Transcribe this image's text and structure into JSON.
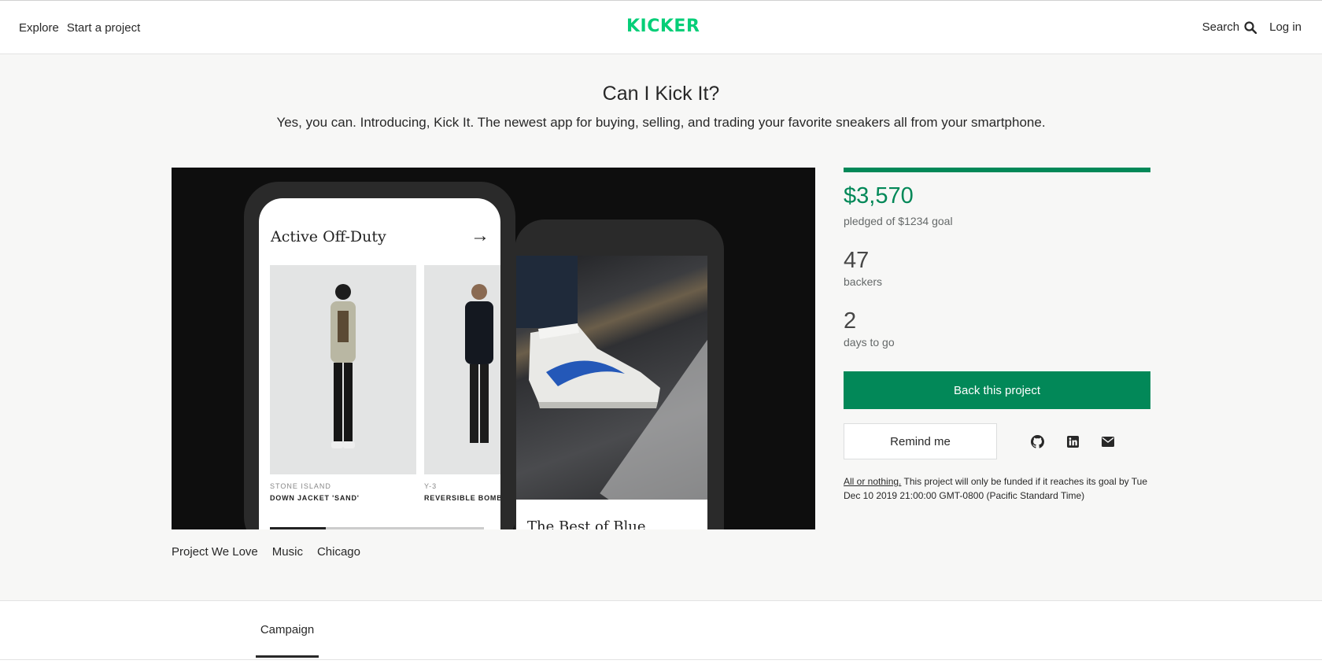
{
  "header": {
    "nav_left": [
      "Explore",
      "Start a project"
    ],
    "logo": "KICKER",
    "search_label": "Search",
    "login_label": "Log in"
  },
  "project": {
    "title": "Can I Kick It?",
    "subtitle": "Yes, you can.  Introducing,  Kick  It. The newest app for buying, selling, and trading your favorite sneakers all from your smartphone.",
    "image": {
      "phone1_title": "Active Off-Duty",
      "card1_brand": "STONE ISLAND",
      "card1_name": "DOWN JACKET 'SAND'",
      "card2_brand": "Y-3",
      "card2_name": "REVERSIBLE BOMBER",
      "phone2_card_text": "The Best of Blue",
      "phone1_scroll_fraction": 0.26
    },
    "tags": [
      "Project We  Love",
      "Music",
      "Chicago"
    ]
  },
  "stats": {
    "progress_fraction": 1.0,
    "pledged_amount": "$3,570",
    "pledged_label": "pledged of $1234 goal",
    "backers_count": "47",
    "backers_label": "backers",
    "days_count": "2",
    "days_label": "days to go"
  },
  "actions": {
    "back_label": "Back this project",
    "remind_label": "Remind me",
    "share_icons": [
      "github-icon",
      "linkedin-icon",
      "email-icon"
    ]
  },
  "funding_note": {
    "link_text": "All or nothing.",
    "text": " This project will only be funded if it reaches its goal by Tue  Dec 10 2019 21:00:00 GMT-0800 (Pacific Standard Time)"
  },
  "tabs": {
    "campaign_label": "Campaign"
  },
  "colors": {
    "brand": "#05ce78",
    "accent": "#028858"
  }
}
